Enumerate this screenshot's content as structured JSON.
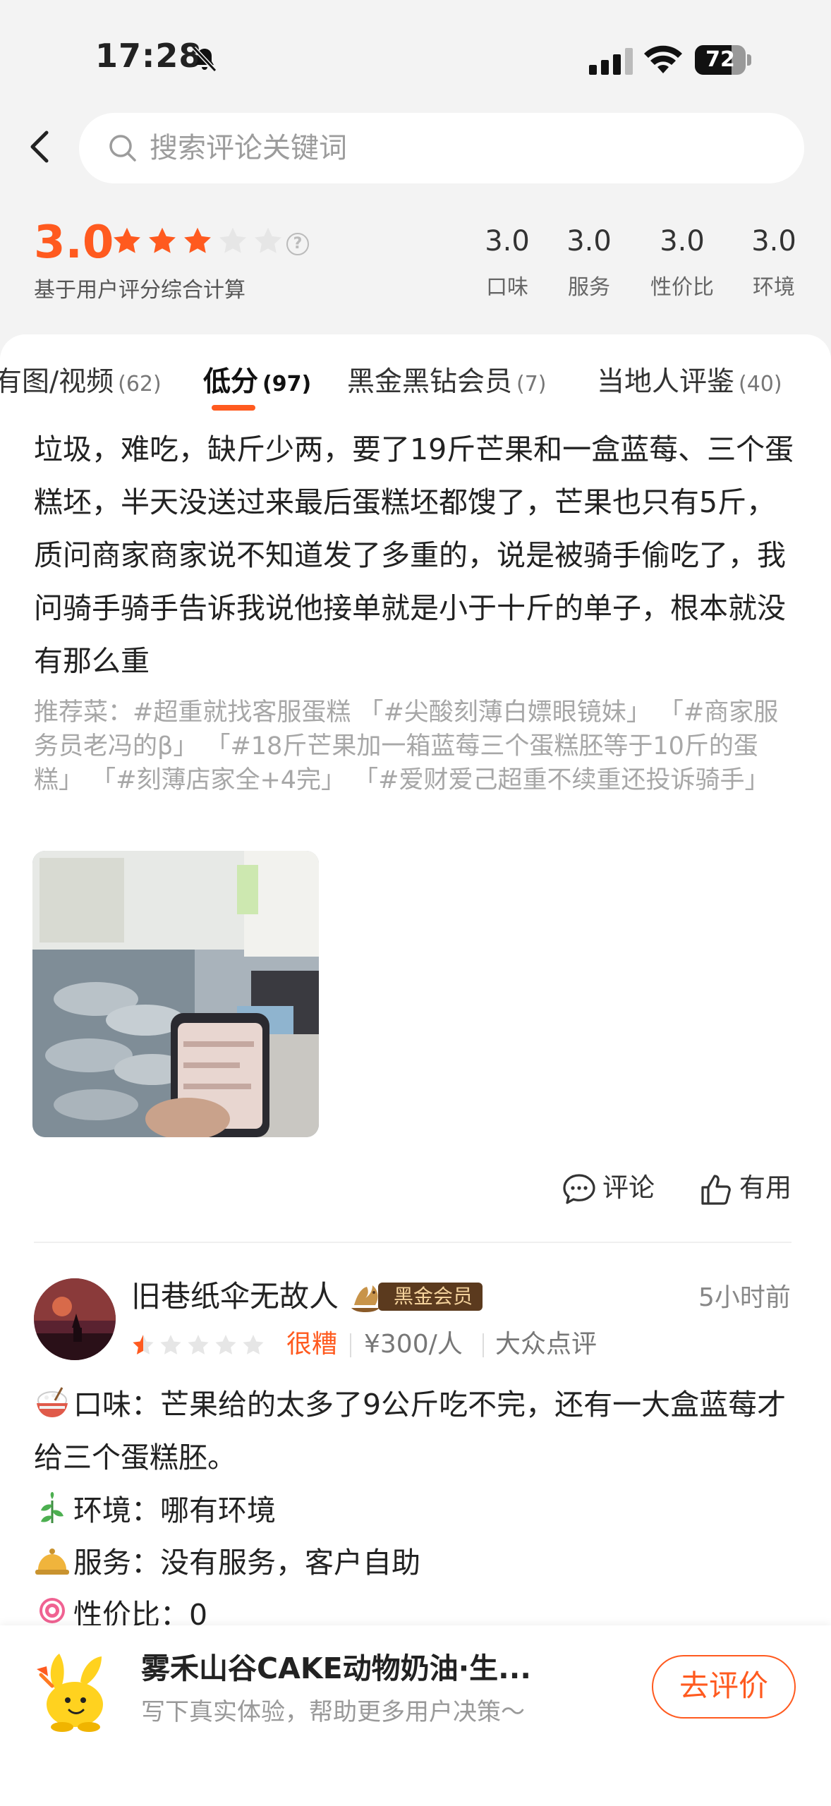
{
  "status_bar": {
    "time": "17:28",
    "battery": "72",
    "battery_level": 0.72
  },
  "search": {
    "placeholder": "搜索评论关键词"
  },
  "rating": {
    "score": "3.0",
    "stars": 3,
    "caption": "基于用户评分综合计算",
    "sub_scores": [
      {
        "value": "3.0",
        "label": "口味"
      },
      {
        "value": "3.0",
        "label": "服务"
      },
      {
        "value": "3.0",
        "label": "性价比"
      },
      {
        "value": "3.0",
        "label": "环境"
      }
    ]
  },
  "tabs": [
    {
      "label": "有图/视频",
      "count": "(62)"
    },
    {
      "label": "低分",
      "count": "(97)",
      "active": true
    },
    {
      "label": "黑金黑钻会员",
      "count": "(7)"
    },
    {
      "label": "当地人评鉴",
      "count": "(40)"
    }
  ],
  "review1": {
    "text": "垃圾，难吃，缺斤少两，要了19斤芒果和一盒蓝莓、三个蛋糕坯，半天没送过来最后蛋糕坯都馊了，芒果也只有5斤，质问商家商家说不知道发了多重的，说是被骑手偷吃了，我问骑手骑手告诉我说他接单就是小于十斤的单子，根本就没有那么重",
    "dishes": "推荐菜：#超重就找客服蛋糕 「#尖酸刻薄白嫖眼镜妹」 「#商家服务员老冯的β」 「#18斤芒果加一箱蓝莓三个蛋糕胚等于10斤的蛋糕」 「#刻薄店家全+4完」 「#爱财爱己超重不续重还投诉骑手」",
    "comment_label": "评论",
    "useful_label": "有用"
  },
  "review2": {
    "username": "旧巷纸伞无故人",
    "badge": "黑金会员",
    "time": "5小时前",
    "stars": 0.5,
    "grade": "很糟",
    "price": "¥300/人",
    "source": "大众点评",
    "lines": [
      {
        "icon": "rice-bowl-icon",
        "text": "口味：芒果给的太多了9公斤吃不完，还有一大盒蓝莓才给三个蛋糕胚。"
      },
      {
        "icon": "leaf-icon",
        "text": "环境：哪有环境"
      },
      {
        "icon": "bell-icon",
        "text": "服务：没有服务，客户自助"
      },
      {
        "icon": "lollipop-icon",
        "text": "性价比：0"
      }
    ]
  },
  "bottom": {
    "shop_name": "雾禾山谷CAKE动物奶油·生...",
    "hint": "写下真实体验，帮助更多用户决策～",
    "cta": "去评价"
  },
  "colors": {
    "accent": "#ff5a1f",
    "badge_bg": "#5b3a1e",
    "badge_text": "#f4d29c"
  }
}
